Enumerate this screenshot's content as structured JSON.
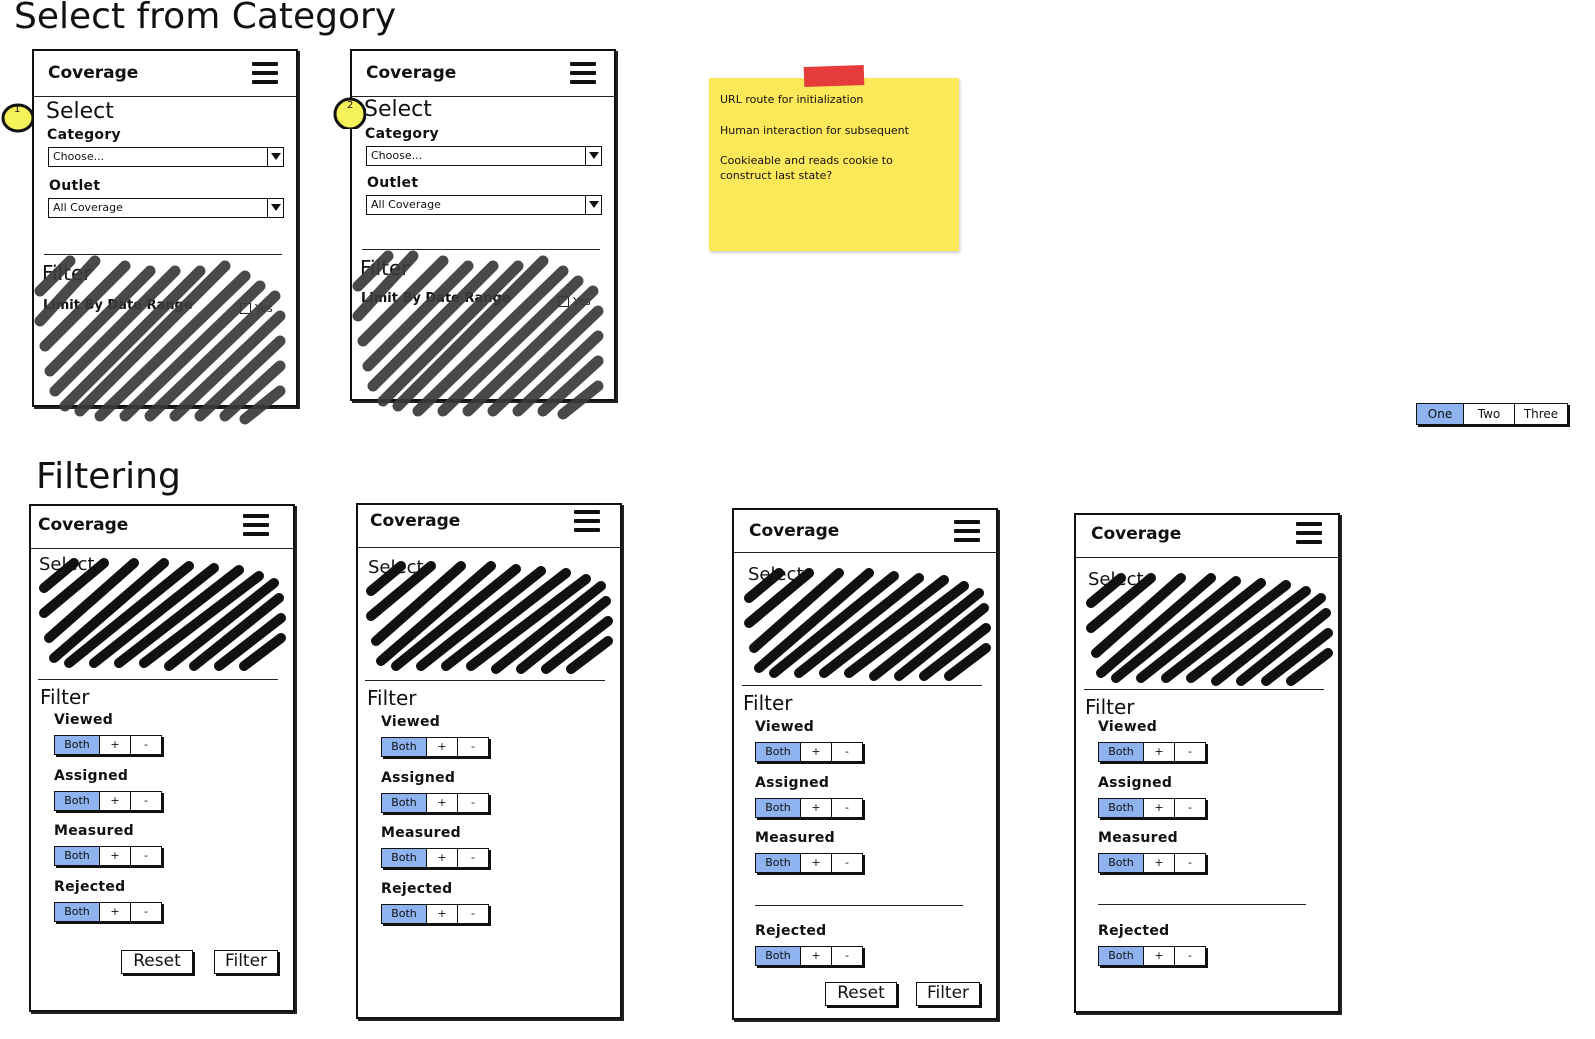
{
  "sections": {
    "select_title": "Select from Category",
    "filtering_title": "Filtering"
  },
  "app": {
    "title": "Coverage",
    "menu_icon": "hamburger-menu-icon"
  },
  "select_form": {
    "select_label": "Select",
    "category_label": "Category",
    "category_value": "Choose...",
    "outlet_label": "Outlet",
    "outlet_value": "All Coverage",
    "filter_label": "Filter",
    "limit_label": "Limit By Date Range",
    "checkbox_label": "Yes"
  },
  "markers": [
    "1",
    "2"
  ],
  "sticky_note": {
    "lines": [
      "URL route for initialization",
      "Human interaction for subsequent",
      "Cookieable and reads cookie to construct last state?"
    ],
    "tape_color": "#e53b3b",
    "color": "#fde85a"
  },
  "segmented_control": {
    "options": [
      "One",
      "Two",
      "Three"
    ],
    "selected": "One"
  },
  "filter_form": {
    "select_label": "Select",
    "filter_label": "Filter",
    "toggle": {
      "both": "Both",
      "plus": "+",
      "minus": "-"
    },
    "rows": [
      "Viewed",
      "Assigned",
      "Measured",
      "Rejected"
    ],
    "reset_label": "Reset",
    "filter_button_label": "Filter"
  },
  "colors": {
    "selected_segment": "#8fb3ef",
    "scribble": "#3a3a3a",
    "scribble_dark": "#111111"
  }
}
